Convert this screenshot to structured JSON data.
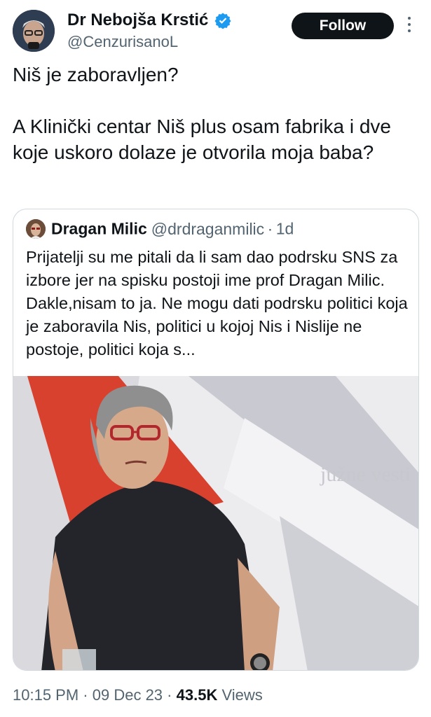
{
  "author": {
    "display_name": "Dr Nebojša Krstić",
    "handle": "@CenzurisanoL",
    "verified": true
  },
  "follow_label": "Follow",
  "tweet_text": "Niš je zaboravljen?\n\nA Klinički centar Niš plus osam fabrika i dve koje uskoro dolaze je otvorila moja baba?",
  "quoted": {
    "display_name": "Dragan Milic",
    "handle": "@drdraganmilic",
    "separator": "·",
    "time": "1d",
    "text": "Prijatelji su me pitali da li sam dao podrsku SNS za izbore jer na spisku postoji ime prof Dragan Milic. Dakle,nisam to ja. Ne mogu dati podrsku politici koja je zaboravila Nis, politici u kojoj Nis i Nislije ne postoje, politici koja s...",
    "media_watermark": "južne vesti"
  },
  "footer": {
    "time": "10:15 PM",
    "sep1": "·",
    "date": "09 Dec 23",
    "sep2": "·",
    "views_count": "43.5K",
    "views_label": "Views"
  },
  "colors": {
    "accent": "#1d9bf0",
    "text": "#0f1419",
    "muted": "#536471",
    "border": "#cfd9de"
  }
}
